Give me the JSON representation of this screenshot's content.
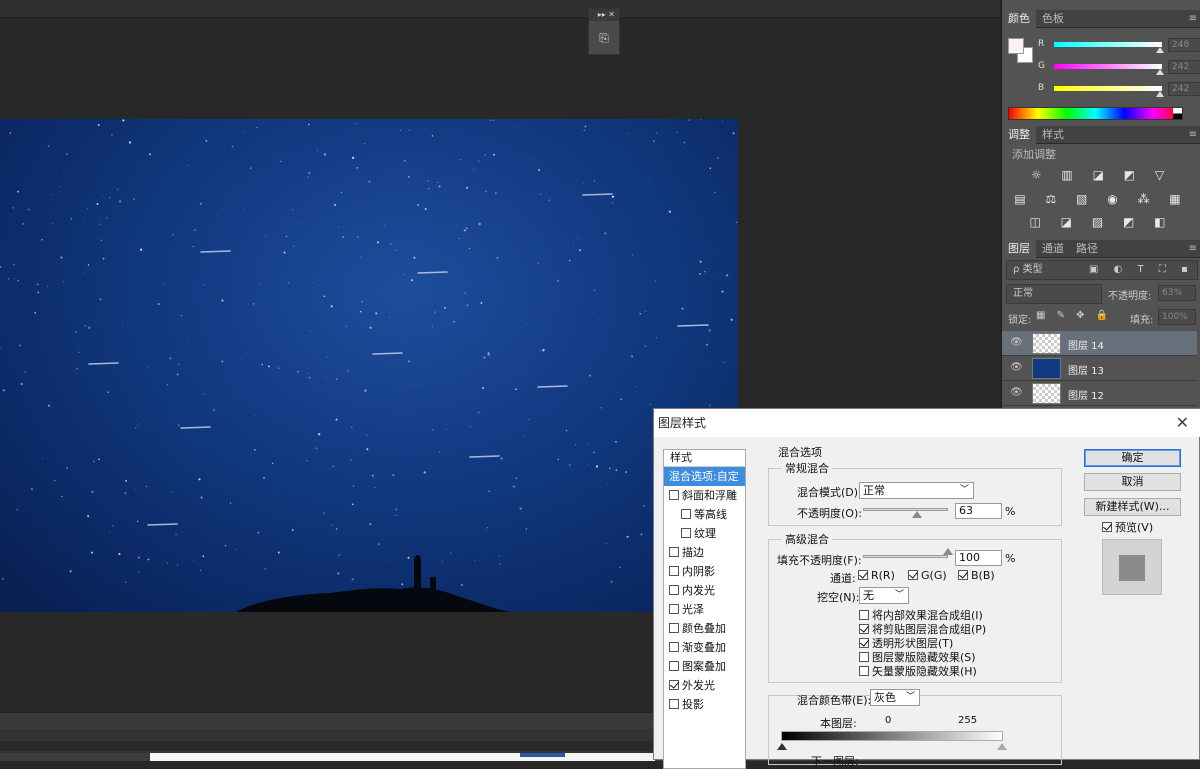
{
  "history_panel": {
    "collapse": "▸▸",
    "close": "✕",
    "icon": "history-icon"
  },
  "right_panel": {
    "color_tabs": [
      "颜色",
      "色板"
    ],
    "color": {
      "channels": [
        {
          "label": "R",
          "value": "248",
          "gradient": "linear-gradient(to right,#0ff,#fff)"
        },
        {
          "label": "G",
          "value": "242",
          "gradient": "linear-gradient(to right,#f0f,#fff)"
        },
        {
          "label": "B",
          "value": "242",
          "gradient": "linear-gradient(to right,#ff0,#fff)"
        }
      ]
    },
    "adjust_tabs": [
      "调整",
      "样式"
    ],
    "adjust_label": "添加调整",
    "adjust_icons_row1": "☼ ▥ ◪ ◩ ▽",
    "adjust_icons_row2": "▤ ⚖ ▧ ◉ ⁂ ▦",
    "adjust_icons_row3": "◫ ◪ ▨ ◩ ◧",
    "layers_tabs": [
      "图层",
      "通道",
      "路径"
    ],
    "filter_label": "ρ 类型",
    "filter_icons": "▣ ◐ T ⛶ ▪",
    "blend_mode": "正常",
    "opacity_label": "不透明度:",
    "opacity_value": "63%",
    "lock_label": "锁定:",
    "lock_icons": "▦ ✎ ✥ 🔒",
    "fill_label": "填充:",
    "fill_value": "100%",
    "layers": [
      {
        "name": "图层 14",
        "selected": true,
        "thumb": "checker"
      },
      {
        "name": "图层 13",
        "selected": false,
        "thumb": "blue"
      },
      {
        "name": "图层 12",
        "selected": false,
        "thumb": "checker"
      }
    ]
  },
  "dialog": {
    "title": "图层样式",
    "styles_header": "样式",
    "styles": [
      {
        "label": "混合选项:自定",
        "selected": true,
        "checkbox": false,
        "checked": false,
        "sub": false
      },
      {
        "label": "斜面和浮雕",
        "selected": false,
        "checkbox": true,
        "checked": false,
        "sub": false
      },
      {
        "label": "等高线",
        "selected": false,
        "checkbox": true,
        "checked": false,
        "sub": true
      },
      {
        "label": "纹理",
        "selected": false,
        "checkbox": true,
        "checked": false,
        "sub": true
      },
      {
        "label": "描边",
        "selected": false,
        "checkbox": true,
        "checked": false,
        "sub": false
      },
      {
        "label": "内阴影",
        "selected": false,
        "checkbox": true,
        "checked": false,
        "sub": false
      },
      {
        "label": "内发光",
        "selected": false,
        "checkbox": true,
        "checked": false,
        "sub": false
      },
      {
        "label": "光泽",
        "selected": false,
        "checkbox": true,
        "checked": false,
        "sub": false
      },
      {
        "label": "颜色叠加",
        "selected": false,
        "checkbox": true,
        "checked": false,
        "sub": false
      },
      {
        "label": "渐变叠加",
        "selected": false,
        "checkbox": true,
        "checked": false,
        "sub": false
      },
      {
        "label": "图案叠加",
        "selected": false,
        "checkbox": true,
        "checked": false,
        "sub": false
      },
      {
        "label": "外发光",
        "selected": false,
        "checkbox": true,
        "checked": true,
        "sub": false
      },
      {
        "label": "投影",
        "selected": false,
        "checkbox": true,
        "checked": false,
        "sub": false
      }
    ],
    "blend_options_title": "混合选项",
    "general_title": "常规混合",
    "blend_mode_label": "混合模式(D):",
    "blend_mode_value": "正常",
    "opacity_label": "不透明度(O):",
    "opacity_value": "63",
    "opacity_level": 0.63,
    "percent": "%",
    "advanced_title": "高级混合",
    "fill_label": "填充不透明度(F):",
    "fill_value": "100",
    "fill_level": 1.0,
    "channels_label": "通道:",
    "channel_r": "R(R)",
    "channel_g": "G(G)",
    "channel_b": "B(B)",
    "knockout_label": "挖空(N):",
    "knockout_value": "无",
    "options": [
      {
        "label": "将内部效果混合成组(I)",
        "checked": false
      },
      {
        "label": "将剪贴图层混合成组(P)",
        "checked": true
      },
      {
        "label": "透明形状图层(T)",
        "checked": true
      },
      {
        "label": "图层蒙版隐藏效果(S)",
        "checked": false
      },
      {
        "label": "矢量蒙版隐藏效果(H)",
        "checked": false
      }
    ],
    "blend_if_label": "混合颜色带(E):",
    "blend_if_value": "灰色",
    "this_layer_label": "本图层:",
    "this_layer_min": "0",
    "this_layer_max": "255",
    "under_layer_label": "下一图层:",
    "ok_label": "确定",
    "cancel_label": "取消",
    "new_style_label": "新建样式(W)...",
    "preview_label": "预览(V)",
    "preview_checked": true
  }
}
